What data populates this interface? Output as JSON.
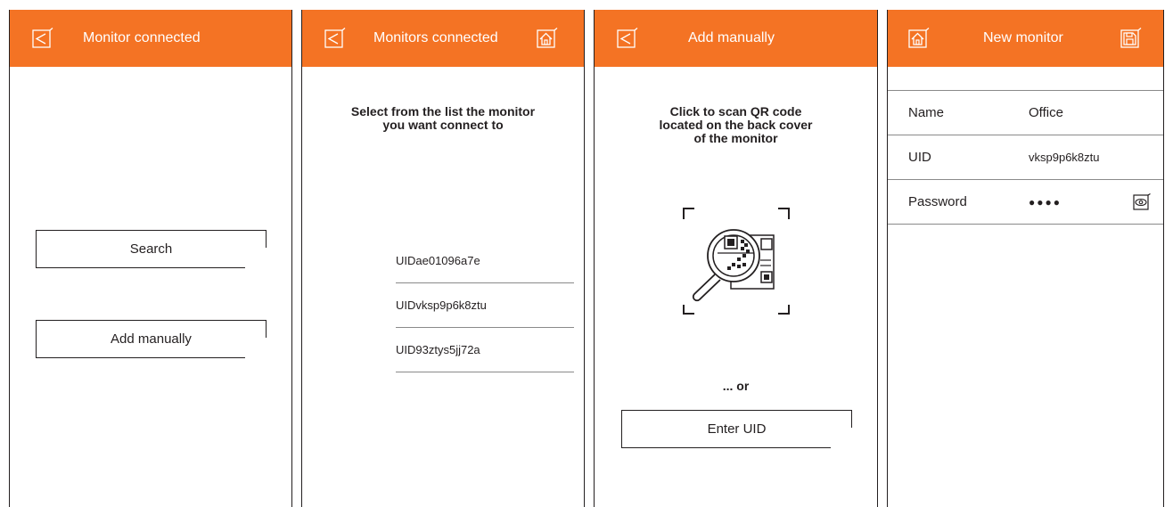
{
  "colors": {
    "header": "#f47324",
    "text": "#231f20",
    "divider": "#8a8a8a"
  },
  "screen1": {
    "title": "Monitor connected",
    "back_icon": "back-arrow-icon",
    "buttons": {
      "search": "Search",
      "add_manually": "Add manually"
    }
  },
  "screen2": {
    "title": "Monitors connected",
    "back_icon": "back-arrow-icon",
    "home_icon": "home-icon",
    "prompt_line1": "Select from the list the monitor",
    "prompt_line2": "you want connect to",
    "items": [
      "UIDae01096a7e",
      "UIDvksp9p6k8ztu",
      "UID93ztys5jj72a"
    ]
  },
  "screen3": {
    "title": "Add manually",
    "back_icon": "back-arrow-icon",
    "prompt_line1": "Click to scan QR code",
    "prompt_line2": "located on the back cover",
    "prompt_line3": "of the monitor",
    "qr_icon": "qr-scan-magnifier-icon",
    "or_text": "... or",
    "enter_uid": "Enter UID"
  },
  "screen4": {
    "title": "New monitor",
    "home_icon": "home-icon",
    "save_icon": "save-icon",
    "fields": [
      {
        "label": "Name",
        "value": "Office"
      },
      {
        "label": "UID",
        "value": "vksp9p6k8ztu"
      },
      {
        "label": "Password",
        "value": "●●●●"
      }
    ],
    "eye_icon": "eye-icon"
  }
}
